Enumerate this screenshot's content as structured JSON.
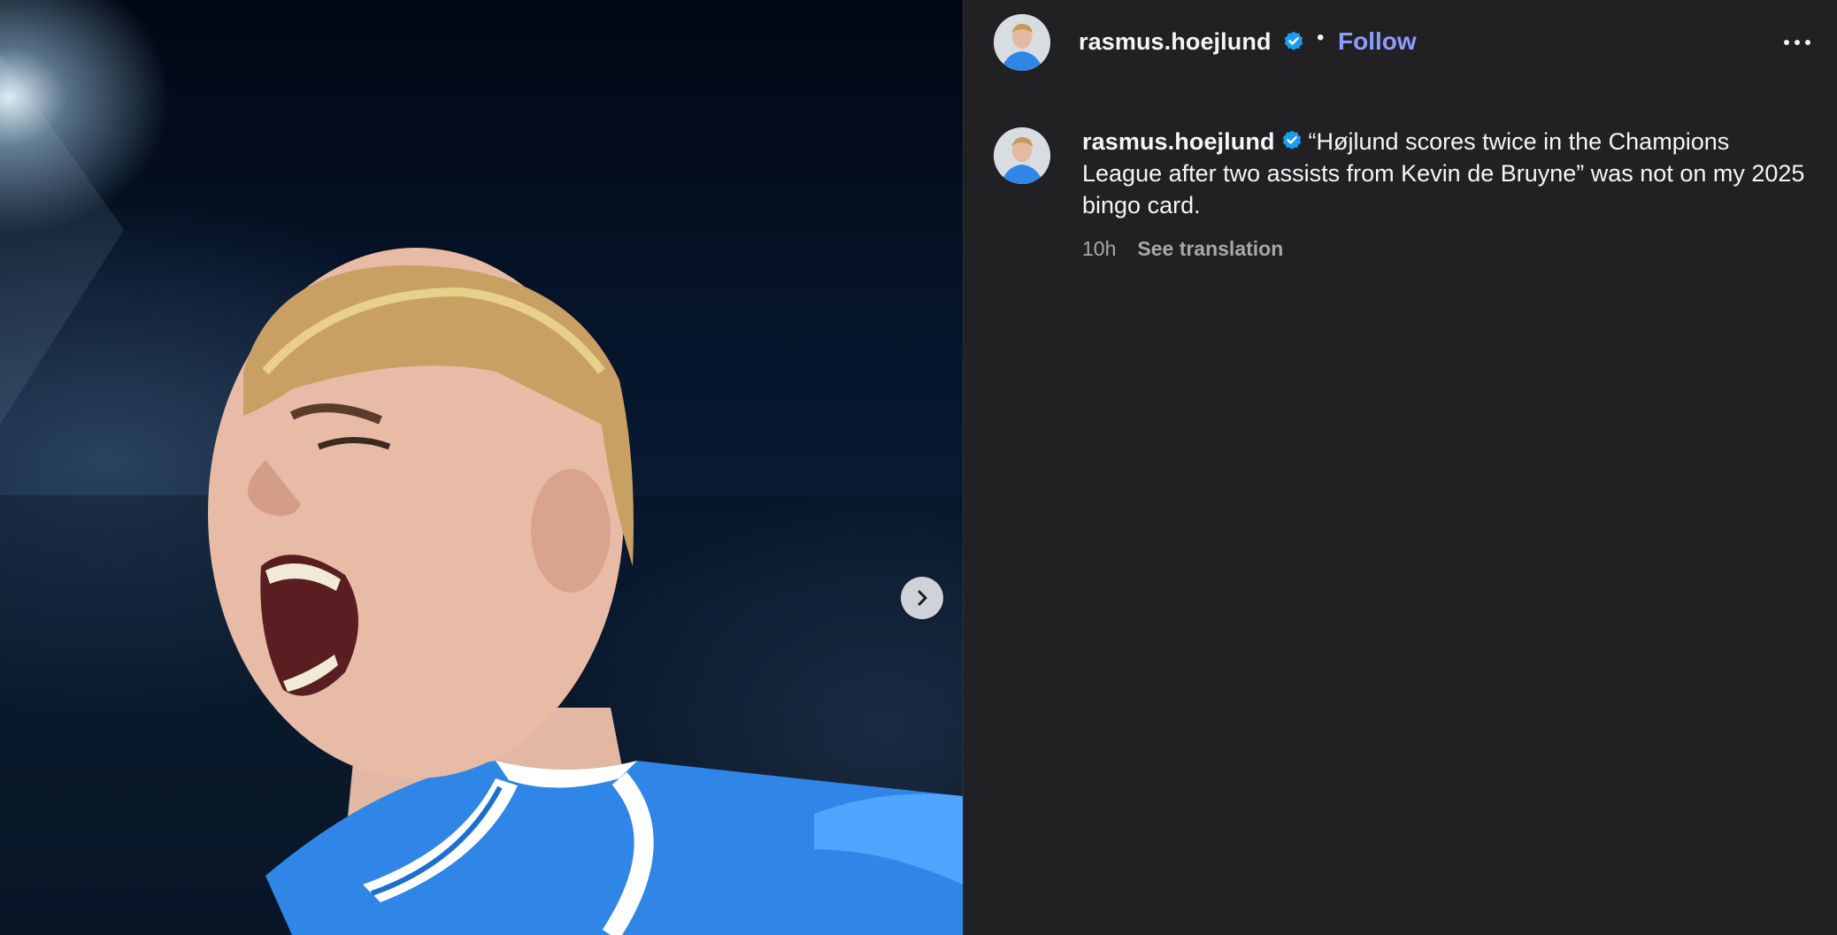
{
  "post": {
    "username": "rasmus.hoejlund",
    "separator": "•",
    "follow_label": "Follow",
    "caption_text": "“Højlund scores twice in the Champions League after two assists from Kevin de Bruyne” was not on my 2025 bingo card.",
    "time_ago": "10h",
    "translate_label": "See translation"
  },
  "icons": {
    "verified": "verified-badge-icon",
    "next": "chevron-right-icon",
    "more": "more-options-icon"
  },
  "colors": {
    "background": "#212123",
    "follow": "#8c9cff",
    "verified": "#1d9bf0",
    "muted_text": "#a8a8a8"
  }
}
